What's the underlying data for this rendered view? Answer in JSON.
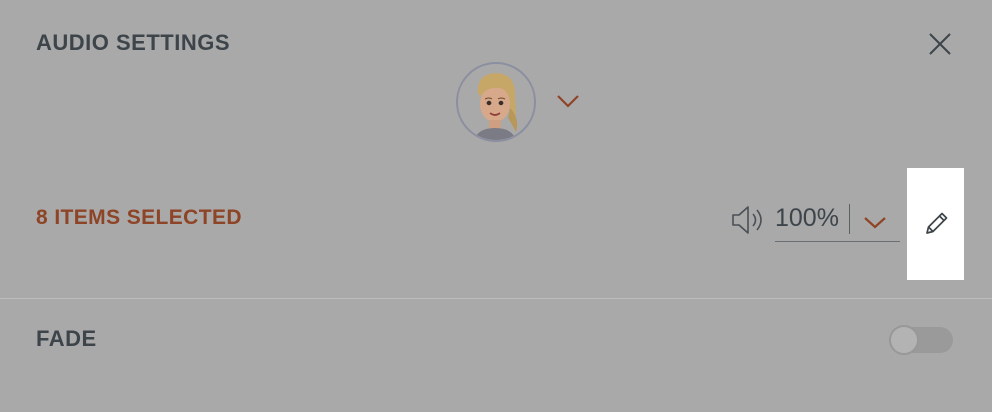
{
  "dialog": {
    "title": "AUDIO SETTINGS",
    "close_icon": "close-icon"
  },
  "voice": {
    "avatar": "avatar-woman",
    "dropdown_icon": "chevron-down-icon"
  },
  "selection": {
    "label": "8 ITEMS SELECTED"
  },
  "volume": {
    "icon": "speaker-icon",
    "value": "100%",
    "dropdown_icon": "chevron-down-icon"
  },
  "edit": {
    "icon": "pencil-icon"
  },
  "fade": {
    "label": "FADE",
    "enabled": false
  },
  "colors": {
    "background": "#a9a9a9",
    "text": "#3d454b",
    "accent": "#8e4426",
    "edit_bg": "#ffffff"
  }
}
